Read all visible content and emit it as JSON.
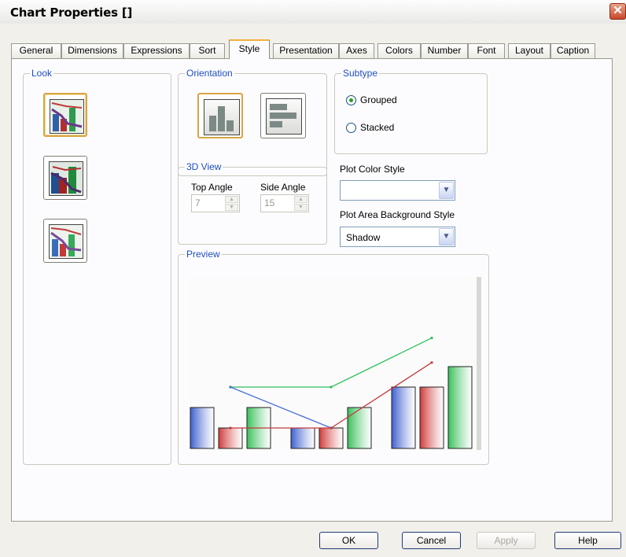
{
  "window": {
    "title": "Chart Properties []",
    "close_glyph": "✕"
  },
  "tabs": [
    "General",
    "Dimensions",
    "Expressions",
    "Sort",
    "Style",
    "Presentation",
    "Axes",
    "Colors",
    "Number",
    "Font",
    "Layout",
    "Caption"
  ],
  "active_tab": "Style",
  "look": {
    "legend": "Look",
    "selected_index": 0
  },
  "orientation": {
    "legend": "Orientation",
    "options": [
      "vertical-bar-icon",
      "horizontal-bar-icon"
    ],
    "selected": "vertical"
  },
  "subtype": {
    "legend": "Subtype",
    "grouped_label": "Grouped",
    "stacked_label": "Stacked",
    "selected": "Grouped"
  },
  "view3d": {
    "legend": "3D View",
    "top_angle_label": "Top Angle",
    "top_angle_value": "7",
    "side_angle_label": "Side Angle",
    "side_angle_value": "15"
  },
  "plot_color_style": {
    "label": "Plot Color Style",
    "value": ""
  },
  "plot_area_bg_style": {
    "label": "Plot Area Background Style",
    "value": "Shadow"
  },
  "preview": {
    "legend": "Preview",
    "groups": [
      {
        "bars": [
          {
            "color": "blue",
            "value": 2
          },
          {
            "color": "red",
            "value": 1
          },
          {
            "color": "green",
            "value": 2
          }
        ]
      },
      {
        "bars": [
          {
            "color": "blue",
            "value": 1
          },
          {
            "color": "red",
            "value": 1
          },
          {
            "color": "green",
            "value": 2
          }
        ]
      },
      {
        "bars": [
          {
            "color": "blue",
            "value": 3
          },
          {
            "color": "red",
            "value": 3
          },
          {
            "color": "green",
            "value": 4
          }
        ]
      }
    ],
    "lines": [
      {
        "color": "#2dbf5c",
        "values": [
          3,
          3,
          5.4
        ]
      },
      {
        "color": "#4a6fd6",
        "values": [
          3,
          1
        ]
      },
      {
        "color": "#c23a3a",
        "values": [
          1,
          1,
          4.2
        ]
      }
    ],
    "ymax": 6
  },
  "colors": {
    "blue": "#3d5fcf",
    "red": "#d23b3b",
    "green": "#38c05a",
    "accent": "#f2b13c",
    "legend_text": "#1f4fc0"
  },
  "buttons": {
    "ok": "OK",
    "cancel": "Cancel",
    "apply": "Apply",
    "help": "Help"
  }
}
